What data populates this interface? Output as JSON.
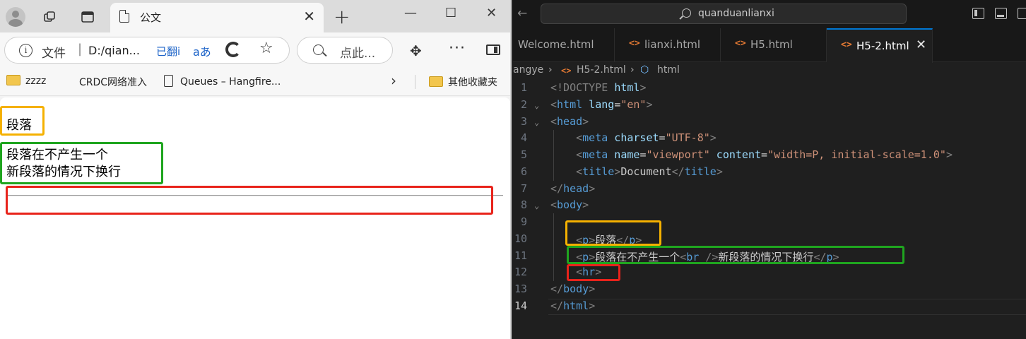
{
  "browser": {
    "tab": {
      "title": "公文",
      "close": "✕"
    },
    "new_tab": "+",
    "window": {
      "minimize": "—",
      "maximize": "☐",
      "close": "✕"
    },
    "address": {
      "info": "i",
      "label": "文件",
      "separator": "|",
      "url": "D:/qian...",
      "translated": "已翻i",
      "read_aloud": "aあ",
      "search_placeholder": "点此..."
    },
    "bookmarks": [
      {
        "label": "zzzz",
        "icon": "folder-icon"
      },
      {
        "label": "CRDC网络准入",
        "icon": "none"
      },
      {
        "label": "Queues – Hangfire...",
        "icon": "page-icon"
      },
      {
        "label": "其他收藏夹",
        "icon": "folder-icon"
      }
    ],
    "bookmarks_more": "›",
    "page": {
      "paragraph1": "段落",
      "paragraph2_line1": "段落在不产生一个",
      "paragraph2_line2": "新段落的情况下换行"
    }
  },
  "vscode": {
    "command_center": "quanduanlianxi",
    "nav_back": "←",
    "nav_forward": "→",
    "tabs": [
      {
        "label": "Welcome.html",
        "icon": "none",
        "active": false
      },
      {
        "label": "lianxi.html",
        "icon": "code-icon",
        "active": false
      },
      {
        "label": "H5.html",
        "icon": "code-icon",
        "active": false
      },
      {
        "label": "H5-2.html",
        "icon": "code-icon",
        "active": true
      }
    ],
    "tab_close": "✕",
    "breadcrumb": {
      "folder": "angye",
      "file": "H5-2.html",
      "symbol": "html",
      "sep": "›"
    },
    "line_numbers": [
      "1",
      "2",
      "3",
      "4",
      "5",
      "6",
      "7",
      "8",
      "9",
      "10",
      "11",
      "12",
      "13",
      "14"
    ],
    "current_line": "14",
    "code": {
      "l1": {
        "open": "<!DOCTYPE ",
        "name": "html",
        "close": ">"
      },
      "l2": {
        "open": "<",
        "tag": "html",
        "attr": " lang",
        "eq": "=",
        "val": "\"en\"",
        "close": ">"
      },
      "l3": {
        "open": "<",
        "tag": "head",
        "close": ">"
      },
      "l4": {
        "open": "<",
        "tag": "meta",
        "attr": " charset",
        "eq": "=",
        "val": "\"UTF-8\"",
        "close": ">"
      },
      "l5": {
        "open": "<",
        "tag": "meta",
        "attr1": " name",
        "eq1": "=",
        "val1": "\"viewport\"",
        "attr2": " content",
        "eq2": "=",
        "val2": "\"width=P, initial-scale=1.0\"",
        "close": ">"
      },
      "l6": {
        "open": "<",
        "tag": "title",
        "gt": ">",
        "text": "Document",
        "open2": "</",
        "tag2": "title",
        "close": ">"
      },
      "l7": {
        "open": "</",
        "tag": "head",
        "close": ">"
      },
      "l8": {
        "open": "<",
        "tag": "body",
        "close": ">"
      },
      "l10": {
        "open": "<",
        "tag": "p",
        "gt": ">",
        "text": "段落",
        "open2": "</",
        "tag2": "p",
        "close": ">"
      },
      "l11": {
        "open": "<",
        "tag": "p",
        "gt": ">",
        "text1": "段落在不产生一个",
        "br_open": "<",
        "br_tag": "br",
        "br_close": " />",
        "text2": "新段落的情况下换行",
        "open2": "</",
        "tag2": "p",
        "close": ">"
      },
      "l12": {
        "open": "<",
        "tag": "hr",
        "close": ">"
      },
      "l13": {
        "open": "</",
        "tag": "body",
        "close": ">"
      },
      "l14": {
        "open": "</",
        "tag": "html",
        "close": ">"
      }
    }
  },
  "highlight_colors": {
    "paragraph": "#f5b100",
    "line_break": "#1fa51f",
    "horizontal_rule": "#e8231b"
  }
}
